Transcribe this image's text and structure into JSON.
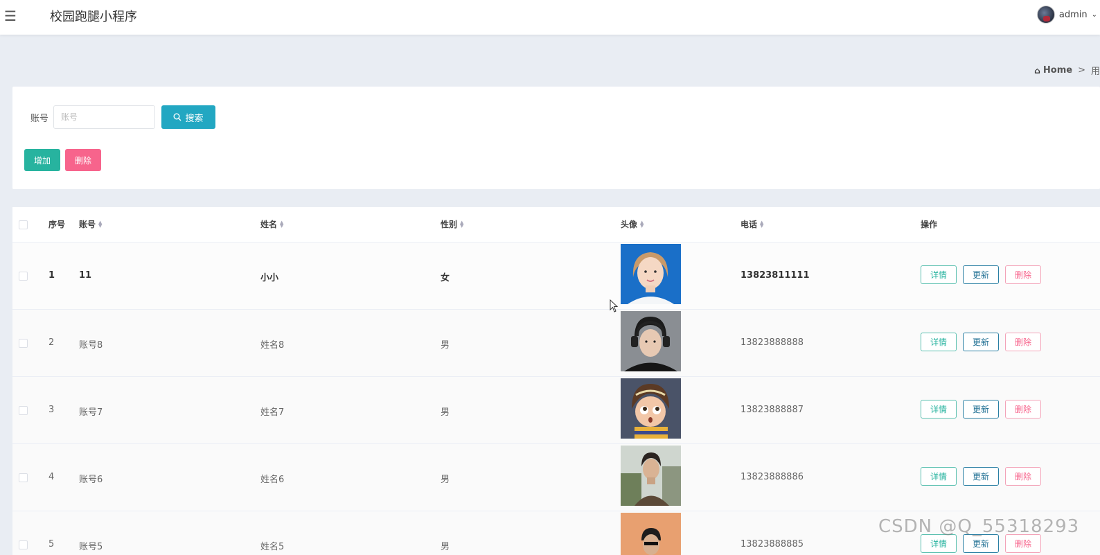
{
  "header": {
    "title": "校园跑腿小程序",
    "user_name": "admin",
    "menu_icon": "menu-icon",
    "dropdown_icon": "chevron-down-icon"
  },
  "breadcrumb": {
    "home": "Home",
    "separator": ">",
    "current": "用"
  },
  "search": {
    "label": "账号",
    "placeholder": "账号",
    "value": "",
    "button_label": "搜索"
  },
  "actions": {
    "add_label": "增加",
    "delete_label": "删除"
  },
  "table": {
    "columns": {
      "index": "序号",
      "account": "账号",
      "name": "姓名",
      "gender": "性别",
      "avatar": "头像",
      "phone": "电话",
      "operations": "操作"
    },
    "row_actions": {
      "detail": "详情",
      "update": "更新",
      "delete": "删除"
    },
    "rows": [
      {
        "index": "1",
        "account": "11",
        "name": "小小",
        "gender": "女",
        "phone": "13823811111"
      },
      {
        "index": "2",
        "account": "账号8",
        "name": "姓名8",
        "gender": "男",
        "phone": "13823888888"
      },
      {
        "index": "3",
        "account": "账号7",
        "name": "姓名7",
        "gender": "男",
        "phone": "13823888887"
      },
      {
        "index": "4",
        "account": "账号6",
        "name": "姓名6",
        "gender": "男",
        "phone": "13823888886"
      },
      {
        "index": "5",
        "account": "账号5",
        "name": "姓名5",
        "gender": "男",
        "phone": "13823888885"
      }
    ]
  },
  "watermark": "CSDN @Q_55318293",
  "colors": {
    "primary": "#22a7c2",
    "success": "#27b39f",
    "danger": "#f7648c",
    "update": "#1f6f93",
    "background": "#e9edf3"
  }
}
